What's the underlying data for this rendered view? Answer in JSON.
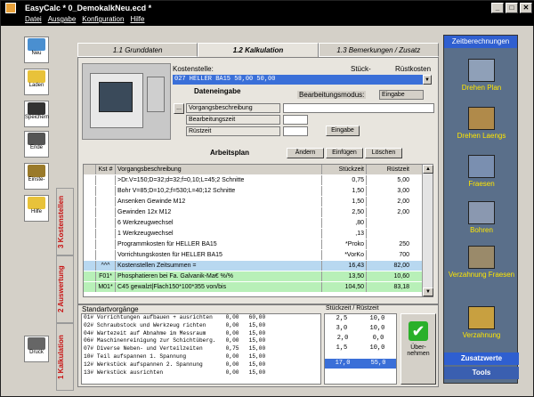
{
  "window": {
    "title": "EasyCalc * 0_DemokalkNeu.ecd *",
    "controls": [
      "_",
      "□",
      "✕"
    ]
  },
  "menu": [
    "Datei",
    "Ausgabe",
    "Konfiguration",
    "Hilfe"
  ],
  "leftbar": [
    {
      "label": "Neu",
      "icon": "new-icon",
      "color": "#4a8fd0"
    },
    {
      "label": "Laden",
      "icon": "folder-icon",
      "color": "#e8c23a"
    },
    {
      "label": "Speichern",
      "icon": "floppy-icon",
      "color": "#333333"
    },
    {
      "label": "Ende",
      "icon": "exit-icon",
      "color": "#555555"
    },
    {
      "label": "Einste-",
      "icon": "settings-icon",
      "color": "#9a7a2a"
    },
    {
      "label": "Hilfe",
      "icon": "help-icon",
      "color": "#e8c23a"
    },
    {
      "label": "Druck",
      "icon": "printer-icon",
      "color": "#666666"
    }
  ],
  "vtabs": [
    "3 Kostenstellen",
    "2 Auswertung",
    "1 Kalkulation"
  ],
  "tabs": [
    "1.1 Grunddaten",
    "1.2 Kalkulation",
    "1.3 Bemerkungen / Zusatz"
  ],
  "kostenstelle": {
    "label": "Kostenstelle:",
    "stueck_label": "Stück-",
    "rust_label": "Rüstkosten",
    "value": "027    HELLER BA15                              50,00   50,00",
    "dropdown": "▼"
  },
  "dateneingabe": {
    "title": "Dateneingabe",
    "modus_label": "Bearbeitungsmodus:",
    "modus_value": "Eingabe",
    "dots_button": "...",
    "fields": [
      {
        "label": "Vorgangsbeschreibung",
        "value": ""
      },
      {
        "label": "Bearbeitungszeit",
        "value": ""
      },
      {
        "label": "Rüstzeit",
        "value": ""
      }
    ],
    "eingabe_button": "Eingabe"
  },
  "arbeitsplan": {
    "title": "Arbeitsplan",
    "buttons": [
      "Ändern",
      "Einfügen",
      "Löschen"
    ],
    "headers": [
      "",
      "Kst #",
      "Vorgangsbeschreibung",
      "Stückzeit",
      "Rüstzeit"
    ],
    "rows": [
      {
        "kst": "",
        "desc": ">Dr.V=150;D=32;d=32;f=0,10;L=45;2 Schnitte",
        "st": "0,75",
        "rz": "5,00",
        "bg": "#ffffff"
      },
      {
        "kst": "",
        "desc": "Bohr V=85;D=10,2;f=530;L=40;12 Schnitte",
        "st": "1,50",
        "rz": "3,00",
        "bg": "#ffffff"
      },
      {
        "kst": "",
        "desc": "Ansenken Gewinde M12",
        "st": "1,50",
        "rz": "2,00",
        "bg": "#ffffff"
      },
      {
        "kst": "",
        "desc": "Gewinden 12x M12",
        "st": "2,50",
        "rz": "2,00",
        "bg": "#ffffff"
      },
      {
        "kst": "",
        "desc": "6  Werkzeugwechsel",
        "st": ",80",
        "rz": "",
        "bg": "#ffffff"
      },
      {
        "kst": "",
        "desc": "1  Werkzeugwechsel",
        "st": ",13",
        "rz": "",
        "bg": "#ffffff"
      },
      {
        "kst": "",
        "desc": "Programmkosten für HELLER BA15",
        "st": "*Proko",
        "rz": "250",
        "bg": "#ffffff"
      },
      {
        "kst": "",
        "desc": "Vorrichtungskosten für HELLER BA15",
        "st": "*VorKo",
        "rz": "700",
        "bg": "#ffffff"
      },
      {
        "kst": "^^^",
        "desc": "     Kostenstellen Zeitsummen  =",
        "st": "16,43",
        "rz": "82,00",
        "bg": "#b8d8f0"
      },
      {
        "kst": "F01*",
        "desc": "Phosphatieren bei Fa. Galvanik-Ma€  %/%",
        "st": "13,50",
        "rz": "10,60",
        "bg": "#b8f0b8"
      },
      {
        "kst": "M01*",
        "desc": "C45 gewalzt|Flach150*100*355     von/bis",
        "st": "104,50",
        "rz": "83,18",
        "bg": "#b8f0b8"
      }
    ]
  },
  "standard": {
    "title": "Standartvorgänge",
    "items": [
      "01# Vorrichtungen aufbauen + ausrichten    0,00   60,00",
      "02# Schraubstock und Werkzeug richten      0,00   15,00",
      "04# Wartezeit auf Abnahme im Messraum      0,00   15,00",
      "06# Maschinenreinigung zur Schichtüberg.   0,00   15,00",
      "07# Diverse Neben- und Verteilzeiten       0,75   15,00",
      "10# Teil aufspannen 1. Spannung            0,00   15,00",
      "12# Werkstück aufspannen 2. Spannung       0,00   15,00",
      "13# Werkstück ausrichten                   0,00   15,00"
    ],
    "sz_header": "Stückzeit / Rüstzeit",
    "sz_rows": [
      [
        "2,5",
        "10,0"
      ],
      [
        "3,0",
        "10,0"
      ],
      [
        "2,0",
        "0,0"
      ],
      [
        "1,5",
        "10,0"
      ],
      [
        "17,0",
        "55,0"
      ]
    ],
    "uebernehmen": "Über-nehmen"
  },
  "rightbar": {
    "header": "Zeitberechnungen",
    "items": [
      "Drehen Plan",
      "Drehen Laengs",
      "Fraesen",
      "Bohren",
      "Verzahnung Fraesen",
      "Verzahnung"
    ],
    "zusatz": "Zusatzwerte",
    "tools": "Tools"
  }
}
